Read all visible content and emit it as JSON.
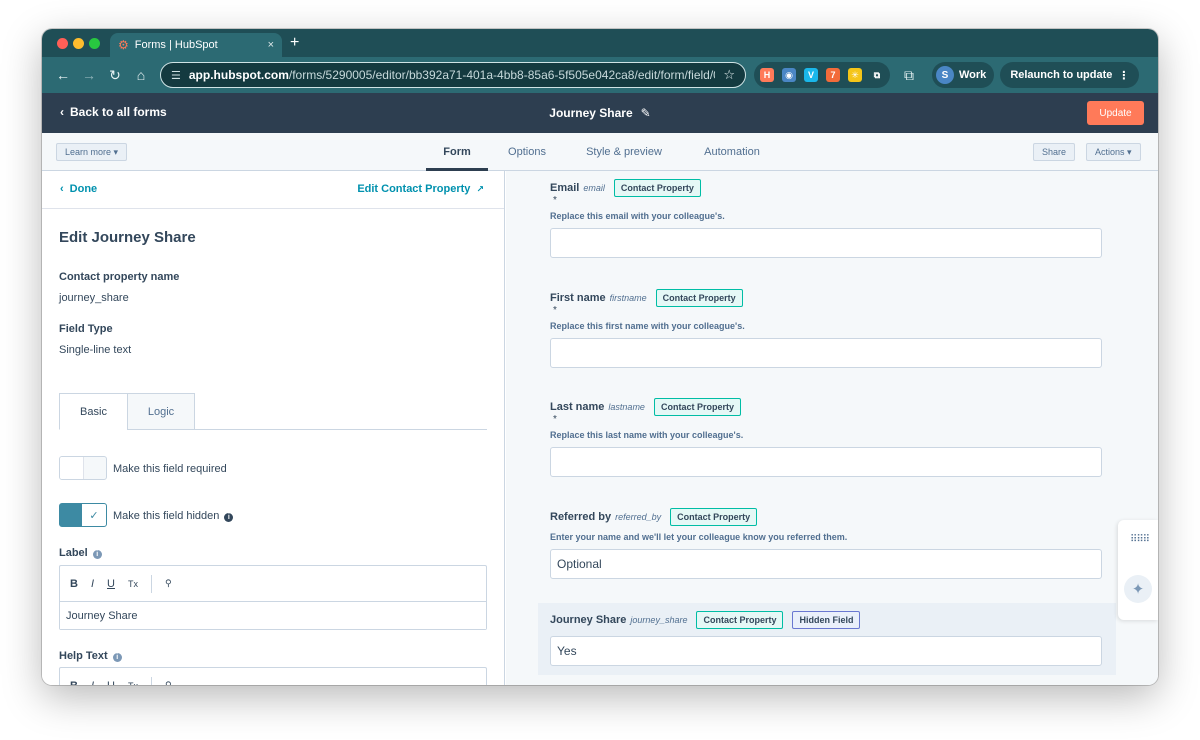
{
  "browser": {
    "tab_title": "Forms | HubSpot",
    "tab_icon": "hubspot-sprocket-icon",
    "new_tab": "+",
    "close_tab": "×",
    "url_host": "app.hubspot.com",
    "url_path": "/forms/5290005/editor/bb392a71-401a-4bb8-85a6-5f505e042ca8/edit/form/field/0-1%2...",
    "profile_initial": "S",
    "profile_label": "Work",
    "relaunch_label": "Relaunch to update",
    "extensions": [
      {
        "name": "hubspot-extension-icon",
        "color": "#ff7a59",
        "glyph": "H"
      },
      {
        "name": "password-manager-extension-icon",
        "color": "#4a86c5",
        "glyph": "◉"
      },
      {
        "name": "vimeo-extension-icon",
        "color": "#1ab7ea",
        "glyph": "V"
      },
      {
        "name": "orange-extension-icon",
        "color": "#f26b3a",
        "glyph": "7"
      },
      {
        "name": "snowflake-extension-icon",
        "color": "#f5c518",
        "glyph": "✳"
      },
      {
        "name": "puzzle-extension-icon",
        "color": "transparent",
        "glyph": "⧉"
      }
    ]
  },
  "header": {
    "back_label": "Back to all forms",
    "form_title": "Journey Share",
    "update_label": "Update",
    "accent_color": "#ff7a59"
  },
  "editor_tabs": {
    "learn_more": "Learn more ▾",
    "tabs": [
      "Form",
      "Options",
      "Style & preview",
      "Automation"
    ],
    "share": "Share",
    "actions": "Actions ▾"
  },
  "left_panel": {
    "done": "Done",
    "edit_property": "Edit Contact Property",
    "heading": "Edit Journey Share",
    "property_name_label": "Contact property name",
    "property_name_value": "journey_share",
    "field_type_label": "Field Type",
    "field_type_value": "Single-line text",
    "subtabs": [
      "Basic",
      "Logic"
    ],
    "required_label": "Make this field required",
    "hidden_label": "Make this field hidden",
    "label_label": "Label",
    "label_value": "Journey Share",
    "help_text_label": "Help Text",
    "toolbar": {
      "bold": "B",
      "italic": "I",
      "underline": "U",
      "clear": "Tx",
      "link": "🔗"
    }
  },
  "preview": {
    "fields": [
      {
        "label": "Email",
        "internal": "email",
        "tag": "Contact Property",
        "required": true,
        "help": "Replace this email with your colleague's.",
        "value": ""
      },
      {
        "label": "First name",
        "internal": "firstname",
        "tag": "Contact Property",
        "required": true,
        "help": "Replace this first name with your colleague's.",
        "value": ""
      },
      {
        "label": "Last name",
        "internal": "lastname",
        "tag": "Contact Property",
        "required": true,
        "help": "Replace this last name with your colleague's.",
        "value": ""
      },
      {
        "label": "Referred by",
        "internal": "referred_by",
        "tag": "Contact Property",
        "required": false,
        "help": "Enter your name and we'll let your colleague know you referred them.",
        "value": "Optional"
      },
      {
        "label": "Journey Share",
        "internal": "journey_share",
        "tag": "Contact Property",
        "tag2": "Hidden Field",
        "required": false,
        "help": "",
        "value": "Yes"
      }
    ],
    "asterisk": "*"
  }
}
